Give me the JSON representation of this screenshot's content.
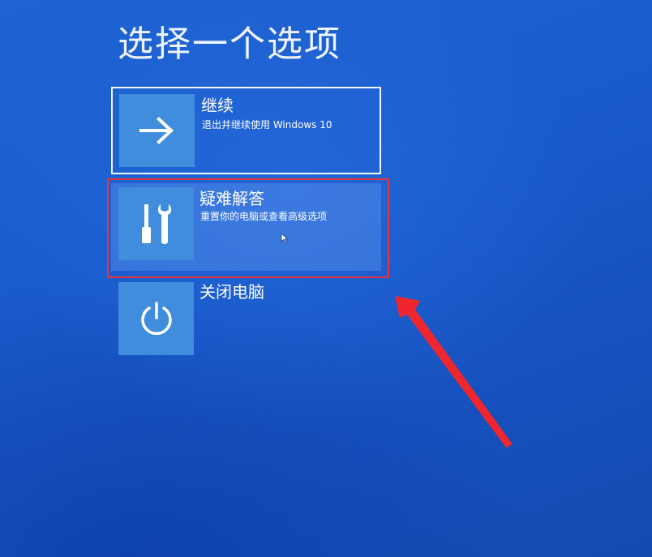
{
  "header": {
    "title": "选择一个选项"
  },
  "options": [
    {
      "id": "continue",
      "title": "继续",
      "description": "退出并继续使用 Windows 10",
      "icon": "arrow-right-icon"
    },
    {
      "id": "troubleshoot",
      "title": "疑难解答",
      "description": "重置你的电脑或查看高级选项",
      "icon": "tools-icon"
    },
    {
      "id": "shutdown",
      "title": "关闭电脑",
      "description": "",
      "icon": "power-icon"
    }
  ],
  "colors": {
    "background": "#1a5bcc",
    "icon_tile": "#3f8ddc",
    "highlight": "#e8323a",
    "annotation_arrow": "#f0262e"
  }
}
